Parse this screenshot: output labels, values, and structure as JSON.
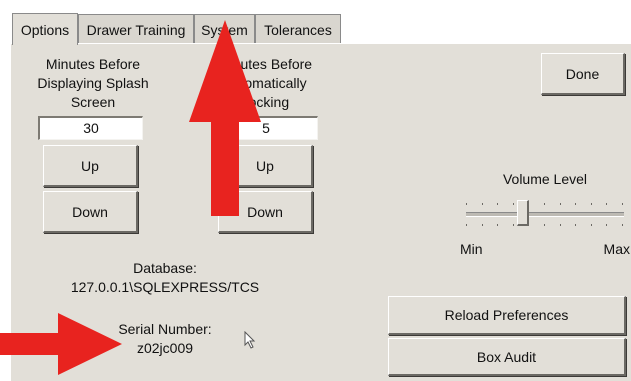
{
  "tabs": [
    {
      "label": "Options",
      "active": true
    },
    {
      "label": "Drawer Training",
      "active": false
    },
    {
      "label": "System",
      "active": false
    },
    {
      "label": "Tolerances",
      "active": false
    }
  ],
  "splash": {
    "label_line1": "Minutes Before",
    "label_line2": "Displaying Splash",
    "label_line3": "Screen",
    "value": "30",
    "up_label": "Up",
    "down_label": "Down"
  },
  "lock": {
    "label_line1": "Minutes Before",
    "label_line2": "Automatically",
    "label_line3": "Locking",
    "value": "5",
    "up_label": "Up",
    "down_label": "Down"
  },
  "done_label": "Done",
  "volume": {
    "label": "Volume Level",
    "min_label": "Min",
    "max_label": "Max",
    "level_fraction": 0.36
  },
  "database": {
    "label": "Database:",
    "value": "127.0.0.1\\SQLEXPRESS/TCS"
  },
  "serial": {
    "label": "Serial Number:",
    "value": "z02jc009"
  },
  "reload_label": "Reload Preferences",
  "box_audit_label": "Box Audit",
  "colors": {
    "panel": "#e2dfd8",
    "arrow": "#e8231f"
  }
}
